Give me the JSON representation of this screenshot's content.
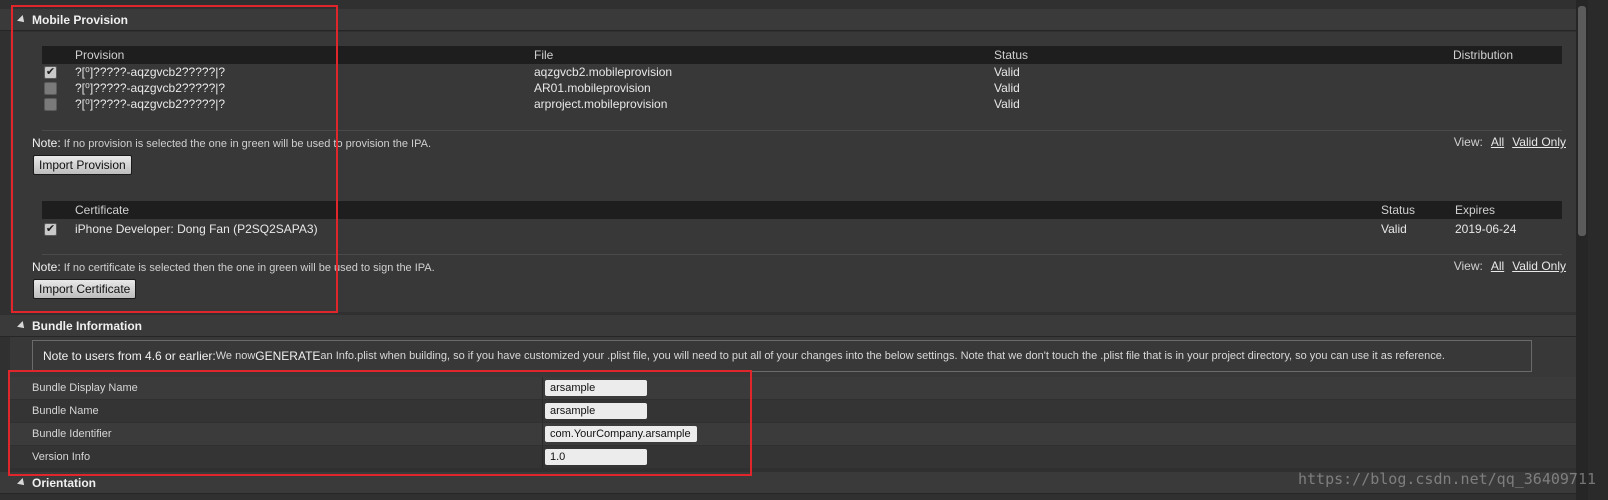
{
  "colors": {
    "background": "#303030",
    "header": "#3a3a3a",
    "table_header": "#1e1e1e",
    "annotation_red": "#e0262b",
    "input_bg": "#ececec"
  },
  "mobile_provision": {
    "title": "Mobile Provision",
    "provision_table": {
      "headers": {
        "provision": "Provision",
        "file": "File",
        "status": "Status",
        "distribution": "Distribution"
      },
      "rows": [
        {
          "checked": true,
          "provision": "?[⁰]?????-aqzgvcb2?????|?",
          "file": "aqzgvcb2.mobileprovision",
          "status": "Valid"
        },
        {
          "checked": false,
          "provision": "?[⁰]?????-aqzgvcb2?????|?",
          "file": "AR01.mobileprovision",
          "status": "Valid"
        },
        {
          "checked": false,
          "provision": "?[⁰]?????-aqzgvcb2?????|?",
          "file": "arproject.mobileprovision",
          "status": "Valid"
        }
      ]
    },
    "provision_note_lead": "Note:",
    "provision_note": " If no provision is selected the one in green will be used to provision the IPA.",
    "view_label": "View:",
    "view_all": "All",
    "view_valid_only": "Valid Only",
    "import_provision": "Import Provision",
    "certificate_table": {
      "headers": {
        "certificate": "Certificate",
        "status": "Status",
        "expires": "Expires"
      },
      "rows": [
        {
          "checked": true,
          "certificate": "iPhone Developer: Dong Fan (P2SQ2SAPA3)",
          "status": "Valid",
          "expires": "2019-06-24"
        }
      ]
    },
    "certificate_note_lead": "Note:",
    "certificate_note": " If no certificate is selected then the one in green will be used to sign the IPA.",
    "import_certificate": "Import Certificate",
    "check_glyph": "✔"
  },
  "bundle_information": {
    "title": "Bundle Information",
    "info_lead": "Note to users from 4.6 or earlier:",
    "info_we_now": " We now ",
    "info_generate": "GENERATE",
    "info_rest": " an Info.plist when building, so if you have customized your .plist file, you will need to put all of your changes into the below settings. Note that we don't touch the .plist file that is in your project directory, so you can use it as reference.",
    "properties": [
      {
        "label": "Bundle Display Name",
        "value": "arsample"
      },
      {
        "label": "Bundle Name",
        "value": "arsample"
      },
      {
        "label": "Bundle Identifier",
        "value": "com.YourCompany.arsample"
      },
      {
        "label": "Version Info",
        "value": "1.0"
      }
    ]
  },
  "orientation": {
    "title": "Orientation"
  },
  "watermark": "https://blog.csdn.net/qq_36409711"
}
